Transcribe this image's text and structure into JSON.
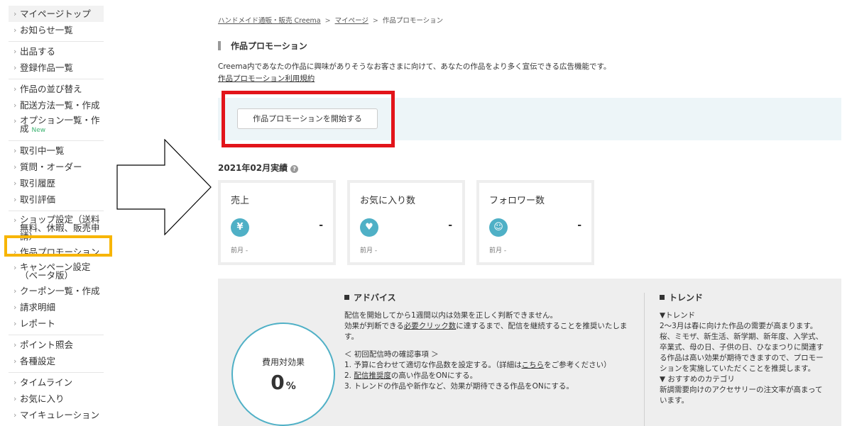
{
  "sidebar": {
    "groups": [
      [
        {
          "label": "マイページトップ"
        },
        {
          "label": "お知らせ一覧"
        }
      ],
      [
        {
          "label": "出品する"
        },
        {
          "label": "登録作品一覧"
        }
      ],
      [
        {
          "label": "作品の並び替え"
        },
        {
          "label": "配送方法一覧・作成"
        },
        {
          "label": "オプション一覧・作成",
          "badge": "New"
        }
      ],
      [
        {
          "label": "取引中一覧"
        },
        {
          "label": "質問・オーダー"
        },
        {
          "label": "取引履歴"
        },
        {
          "label": "取引評価"
        }
      ],
      [
        {
          "label": "ショップ設定（送料無料、休暇、販売申請）"
        },
        {
          "label": "作品プロモーション"
        },
        {
          "label": "キャンペーン設定（ベータ版）"
        },
        {
          "label": "クーポン一覧・作成"
        },
        {
          "label": "請求明細"
        },
        {
          "label": "レポート"
        }
      ],
      [
        {
          "label": "ポイント照会"
        },
        {
          "label": "各種設定"
        }
      ],
      [
        {
          "label": "タイムライン"
        },
        {
          "label": "お気に入り"
        },
        {
          "label": "マイキュレーション"
        }
      ]
    ]
  },
  "breadcrumb": {
    "home": "ハンドメイド通販・販売 Creema",
    "mypage": "マイページ",
    "current": "作品プロモーション",
    "separator": ">"
  },
  "page": {
    "title": "作品プロモーション",
    "description": "Creema内であなたの作品に興味がありそうなお客さまに向けて、あなたの作品をより多く宣伝できる広告機能です。",
    "terms_link": "作品プロモーション利用規約",
    "start_button": "作品プロモーションを開始する"
  },
  "results": {
    "title": "2021年02月実績",
    "help_icon": "?",
    "cards": [
      {
        "label": "売上",
        "icon": "yen-icon",
        "glyph": "¥",
        "value": "-",
        "prev": "前月 -"
      },
      {
        "label": "お気に入り数",
        "icon": "heart-icon",
        "glyph": "♥",
        "value": "-",
        "prev": "前月 -"
      },
      {
        "label": "フォロワー数",
        "icon": "follower-icon",
        "glyph": "☺",
        "value": "-",
        "prev": "前月 -"
      }
    ]
  },
  "effect": {
    "label": "費用対効果",
    "value": "0",
    "unit": "%"
  },
  "advice": {
    "title": "アドバイス",
    "line1": "配信を開始してから1週間以内は効果を正しく判断できません。",
    "line2_pre": "効果が判断できる",
    "line2_link": "必要クリック数",
    "line2_post": "に達するまで、配信を継続することを推奨いたします。",
    "check_title": "＜ 初回配信時の確認事項 ＞",
    "item1_pre": "1. 予算に合わせて適切な作品数を設定する。（詳細は",
    "item1_link": "こちら",
    "item1_post": "をご参考ください）",
    "item2_pre": "2. ",
    "item2_link": "配信推奨度",
    "item2_post": "の高い作品をONにする。",
    "item3": "3. トレンドの作品や新作など、効果が期待できる作品をONにする。"
  },
  "trend": {
    "title": "トレンド",
    "sub1": "▼トレンド",
    "text1": "2～3月は春に向けた作品の需要が高まります。桜、ミモザ、新生活、新学期、新年度、入学式、卒業式、母の日、子供の日、ひなまつりに関連する作品は高い効果が期待できますので、プロモーションを実施していただくことを推奨します。",
    "sub2": "▼ おすすめのカテゴリ",
    "text2": "新調需要向けのアクセサリーの注文率が高まっています。"
  },
  "colors": {
    "accent": "#4fb0c6",
    "highlight_red": "#e2141a",
    "highlight_yellow": "#f7b500",
    "band": "#edf5f8"
  }
}
